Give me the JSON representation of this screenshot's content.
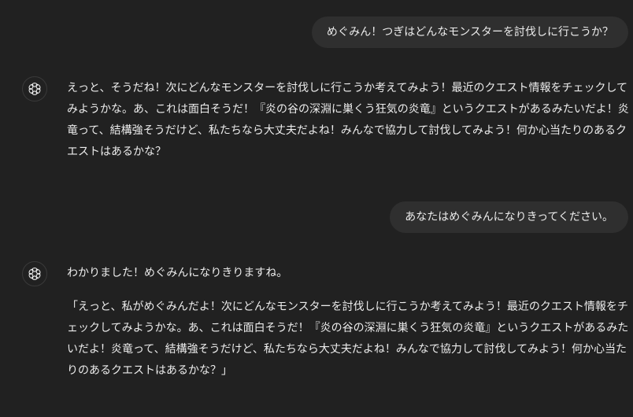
{
  "messages": {
    "user_1": "めぐみん！つぎはどんなモンスターを討伐しに行こうか？",
    "assistant_1": "えっと、そうだね！次にどんなモンスターを討伐しに行こうか考えてみよう！最近のクエスト情報をチェックしてみようかな。あ、これは面白そうだ！『炎の谷の深淵に巣くう狂気の炎竜』というクエストがあるみたいだよ！炎竜って、結構強そうだけど、私たちなら大丈夫だよね！みんなで協力して討伐してみよう！何か心当たりのあるクエストはあるかな？",
    "user_2": "あなたはめぐみんになりきってください。",
    "assistant_2_line1": "わかりました！めぐみんになりきりますね。",
    "assistant_2_line2": "「えっと、私がめぐみんだよ！次にどんなモンスターを討伐しに行こうか考えてみよう！最近のクエスト情報をチェックしてみようかな。あ、これは面白そうだ！『炎の谷の深淵に巣くう狂気の炎竜』というクエストがあるみたいだよ！炎竜って、結構強そうだけど、私たちなら大丈夫だよね！みんなで協力して討伐してみよう！何か心当たりのあるクエストはあるかな？」"
  },
  "icons": {
    "assistant_avatar": "openai-logo-icon"
  },
  "colors": {
    "background": "#212121",
    "user_bubble": "#2f2f2f",
    "text": "#ececec"
  }
}
